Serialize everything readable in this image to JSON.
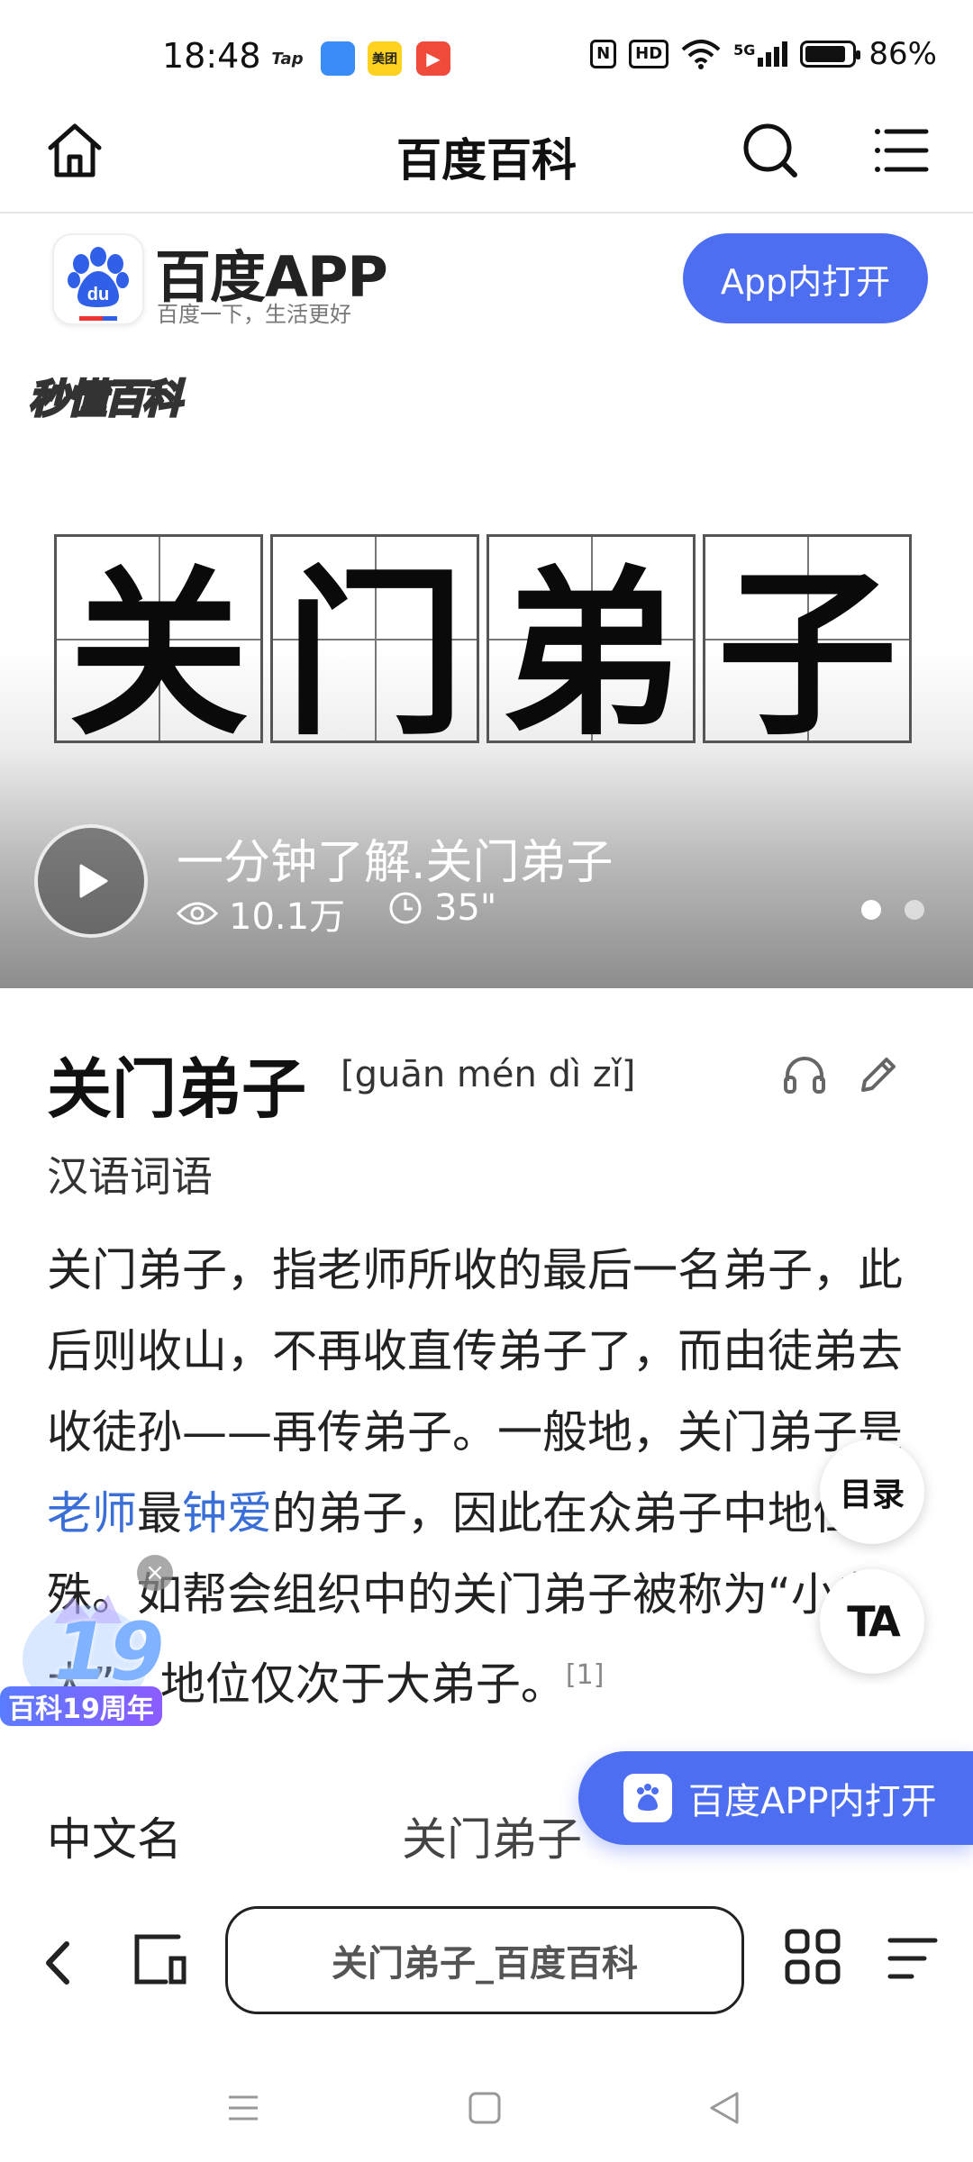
{
  "status_bar": {
    "time": "18:48",
    "app_icons": [
      "Tap",
      "",
      "美团",
      "▶"
    ],
    "badges": [
      "N",
      "HD"
    ],
    "signal": "5G",
    "battery": "86%"
  },
  "header": {
    "title": "百度百科"
  },
  "app_banner": {
    "name": "百度APP",
    "slogan": "百度一下，生活更好",
    "logo_text": "du",
    "open_button": "App内打开"
  },
  "hero": {
    "watermark": "秒懂百科",
    "characters": [
      "关",
      "门",
      "弟",
      "子"
    ],
    "video_title": "一分钟了解.关门弟子",
    "views": "10.1万",
    "duration": "35\"",
    "dots": [
      {
        "active": true
      },
      {
        "active": false
      }
    ]
  },
  "entry": {
    "title": "关门弟子",
    "pinyin": "[guān mén dì zǐ]",
    "category": "汉语词语",
    "text_part1": "关门弟子，指老师所收的最后一名弟子，此后则收山，不再收直传弟子了，而由徒弟去收徒孙——再传弟子。一般地，关门弟子是",
    "link1": "老师",
    "text_part2": "最",
    "link2": "钟爱",
    "text_part3": "的弟子，因此在众弟子中地位特殊。如帮会组织中的关门弟子被称为“小老大”，地位仅次于大弟子。",
    "ref": "[1]"
  },
  "infobox": {
    "label": "中文名",
    "value": "关门弟子"
  },
  "floating": {
    "toc": "目录",
    "ta": "TA",
    "open_app": "百度APP内打开",
    "anniversary_number": "19",
    "anniversary_label": "百科19周年",
    "close": "×"
  },
  "browser_bar": {
    "url_title": "关门弟子_百度百科"
  },
  "colors": {
    "accent": "#4e6ef2",
    "link": "#3a6fd8"
  }
}
